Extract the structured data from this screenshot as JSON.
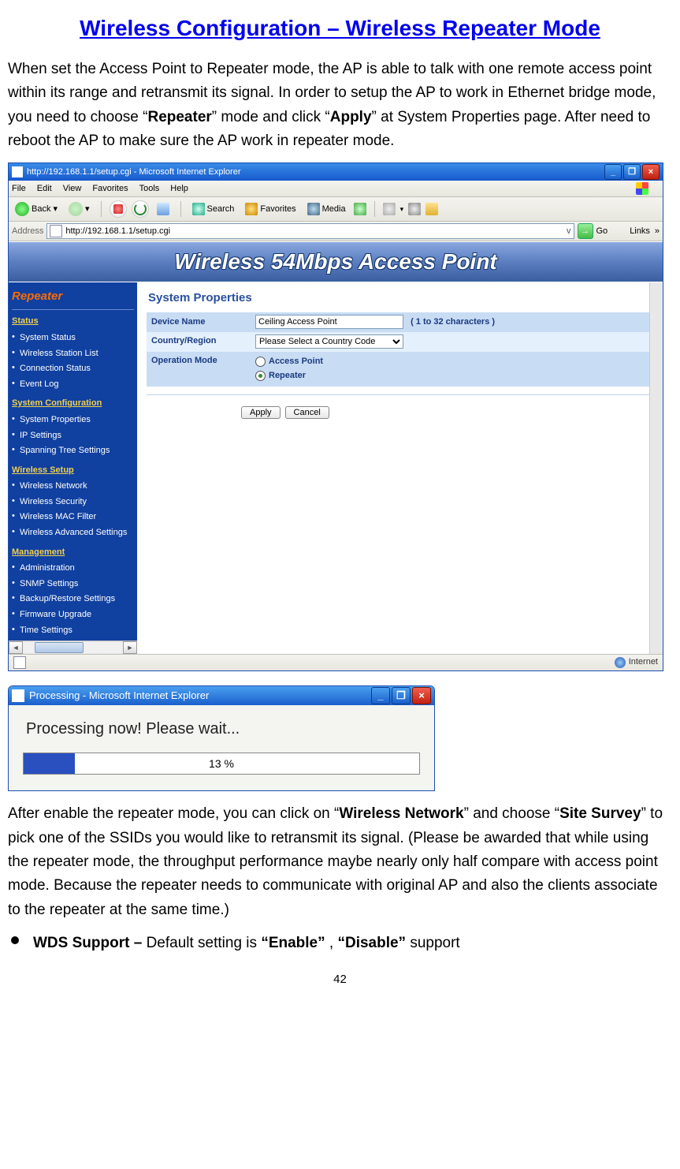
{
  "doc": {
    "title": "Wireless Configuration – Wireless Repeater Mode",
    "intro_before_repeater": "When set the Access Point to Repeater mode, the AP is able to talk with one remote access point within its range and retransmit its signal. In order to setup the AP to work in Ethernet bridge mode, you need to choose “",
    "kw_repeater": "Repeater",
    "intro_mid": "” mode and click “",
    "kw_apply": "Apply",
    "intro_after": "” at System Properties page. After need to reboot the AP to make sure the AP work in repeater mode.",
    "para2_a": "After enable the repeater mode, you can click on “",
    "kw_wn": "Wireless Network",
    "para2_b": "” and choose “",
    "kw_ss": "Site Survey",
    "para2_c": "” to pick one of the SSIDs you would like to retransmit its signal. (Please be awarded that while using the repeater mode, the throughput performance maybe nearly only half compare with access point mode. Because the repeater needs to communicate with original AP and also the clients associate to the repeater at the same time.)",
    "bullet_wds_label": "WDS Support – ",
    "bullet_wds_a": "Default setting is ",
    "kw_enable": "“Enable”",
    "bullet_wds_b": " , ",
    "kw_disable": "“Disable”",
    "bullet_wds_c": " support",
    "page_number": "42"
  },
  "ie1": {
    "title": "http://192.168.1.1/setup.cgi - Microsoft Internet Explorer",
    "menu": {
      "file": "File",
      "edit": "Edit",
      "view": "View",
      "favorites": "Favorites",
      "tools": "Tools",
      "help": "Help"
    },
    "toolbar": {
      "back": "Back",
      "search": "Search",
      "favorites": "Favorites",
      "media": "Media"
    },
    "addr_label": "Address",
    "addr_value": "http://192.168.1.1/setup.cgi",
    "go": "Go",
    "links": "Links",
    "status_zone": "Internet"
  },
  "router": {
    "banner": "Wireless 54Mbps Access Point",
    "mode": "Repeater",
    "groups": {
      "status": {
        "header": "Status",
        "items": [
          "System Status",
          "Wireless Station List",
          "Connection Status",
          "Event Log"
        ]
      },
      "syscfg": {
        "header": "System Configuration",
        "items": [
          "System Properties",
          "IP Settings",
          "Spanning Tree Settings"
        ]
      },
      "wsetup": {
        "header": "Wireless Setup",
        "items": [
          "Wireless Network",
          "Wireless Security",
          "Wireless MAC Filter",
          "Wireless Advanced Settings"
        ]
      },
      "mgmt": {
        "header": "Management",
        "items": [
          "Administration",
          "SNMP Settings",
          "Backup/Restore Settings",
          "Firmware Upgrade",
          "Time Settings"
        ]
      }
    },
    "content": {
      "title": "System Properties",
      "device_name_label": "Device Name",
      "device_name_value": "Ceiling Access Point",
      "device_name_hint": "( 1 to 32 characters )",
      "country_label": "Country/Region",
      "country_value": "Please Select a Country Code",
      "opmode_label": "Operation Mode",
      "opmode_ap": "Access Point",
      "opmode_rep": "Repeater",
      "apply_btn": "Apply",
      "cancel_btn": "Cancel"
    }
  },
  "proc": {
    "title": "Processing - Microsoft Internet Explorer",
    "message": "Processing now! Please wait...",
    "percent": "13 %"
  }
}
